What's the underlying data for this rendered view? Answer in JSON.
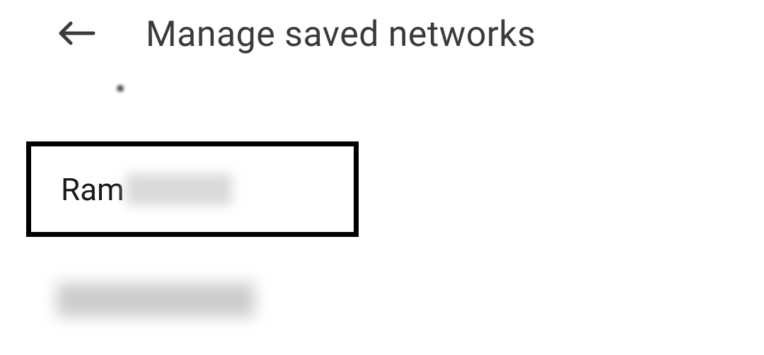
{
  "header": {
    "title": "Manage saved networks"
  },
  "networks": {
    "items": [
      {
        "visibleLabel": "Ram"
      },
      {
        "visibleLabel": ""
      }
    ]
  }
}
